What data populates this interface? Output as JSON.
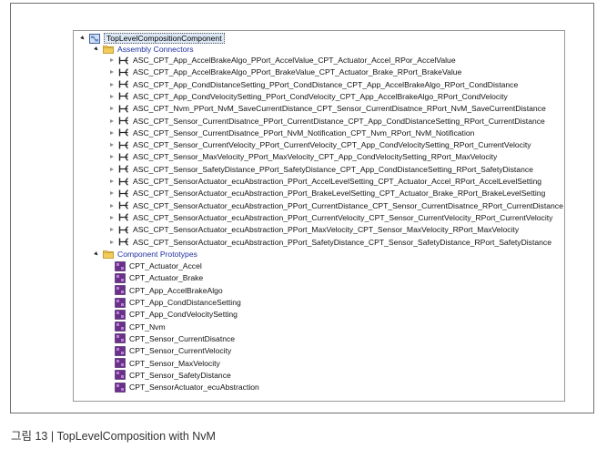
{
  "root": {
    "label": "TopLevelCompositionComponent",
    "icon": "composition-icon"
  },
  "assembly_connectors": {
    "label": "Assembly Connectors",
    "icon": "folder-icon",
    "items": [
      "ASC_CPT_App_AccelBrakeAlgo_PPort_AccelValue_CPT_Actuator_Accel_RPor_AccelValue",
      "ASC_CPT_App_AccelBrakeAlgo_PPort_BrakeValue_CPT_Actuator_Brake_RPort_BrakeValue",
      "ASC_CPT_App_CondDistanceSetting_PPort_CondDistance_CPT_App_AccelBrakeAlgo_RPort_CondDistance",
      "ASC_CPT_App_CondVelocitySetting_PPort_CondVelocity_CPT_App_AccelBrakeAlgo_RPort_CondVelocity",
      "ASC_CPT_Nvm_PPort_NvM_SaveCurrentDistance_CPT_Sensor_CurrentDisatnce_RPort_NvM_SaveCurrentDistance",
      "ASC_CPT_Sensor_CurrentDisatnce_PPort_CurrentDistance_CPT_App_CondDistanceSetting_RPort_CurrentDistance",
      "ASC_CPT_Sensor_CurrentDisatnce_PPort_NvM_Notification_CPT_Nvm_RPort_NvM_Notification",
      "ASC_CPT_Sensor_CurrentVelocity_PPort_CurrentVelocity_CPT_App_CondVelocitySetting_RPort_CurrentVelocity",
      "ASC_CPT_Sensor_MaxVelocity_PPort_MaxVelocity_CPT_App_CondVelocitySetting_RPort_MaxVelocity",
      "ASC_CPT_Sensor_SafetyDistance_PPort_SafetyDistance_CPT_App_CondDistanceSetting_RPort_SafetyDistance",
      "ASC_CPT_SensorActuator_ecuAbstraction_PPort_AccelLevelSetting_CPT_Actuator_Accel_RPort_AccelLevelSetting",
      "ASC_CPT_SensorActuator_ecuAbstraction_PPort_BrakeLevelSetting_CPT_Actuator_Brake_RPort_BrakeLevelSetting",
      "ASC_CPT_SensorActuator_ecuAbstraction_PPort_CurrentDistance_CPT_Sensor_CurrentDisatnce_RPort_CurrentDistance",
      "ASC_CPT_SensorActuator_ecuAbstraction_PPort_CurrentVelocity_CPT_Sensor_CurrentVelocity_RPort_CurrentVelocity",
      "ASC_CPT_SensorActuator_ecuAbstraction_PPort_MaxVelocity_CPT_Sensor_MaxVelocity_RPort_MaxVelocity",
      "ASC_CPT_SensorActuator_ecuAbstraction_PPort_SafetyDistance_CPT_Sensor_SafetyDistance_RPort_SafetyDistance"
    ]
  },
  "component_prototypes": {
    "label": "Component Prototypes",
    "icon": "folder-icon",
    "items": [
      "CPT_Actuator_Accel",
      "CPT_Actuator_Brake",
      "CPT_App_AccelBrakeAlgo",
      "CPT_App_CondDistanceSetting",
      "CPT_App_CondVelocitySetting",
      "CPT_Nvm",
      "CPT_Sensor_CurrentDisatnce",
      "CPT_Sensor_CurrentVelocity",
      "CPT_Sensor_MaxVelocity",
      "CPT_Sensor_SafetyDistance",
      "CPT_SensorActuator_ecuAbstraction"
    ]
  },
  "icons": {
    "connector": "connector-icon",
    "prototype": "component-prototype-icon",
    "expanded": "expanded-arrow-icon",
    "collapsed": "collapsed-arrow-icon"
  },
  "colors": {
    "prototype_icon": "#6b2f8c",
    "folder": "#e6b53a",
    "group_label": "#1f2fa0",
    "root_highlight": "#dde8f6"
  },
  "caption": "그림 13 | TopLevelComposition with NvM"
}
